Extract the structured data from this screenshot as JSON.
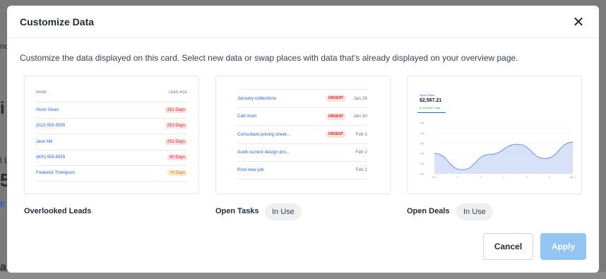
{
  "background": {
    "fragments": [
      "nd",
      "i",
      "l L",
      "5",
      "E",
      "al"
    ]
  },
  "modal": {
    "title": "Customize Data",
    "description": "Customize the data displayed on this card. Select new data or swap places with data that’s already displayed on your overview page.",
    "cancel_label": "Cancel",
    "apply_label": "Apply"
  },
  "cards": {
    "leads": {
      "label": "Overlooked Leads",
      "col_name": "NAME",
      "col_age": "LEAD AGE",
      "rows": [
        {
          "name": "Victor Swan",
          "age": "251 Days",
          "status": "red"
        },
        {
          "name": "(512) 555-5555",
          "age": "251 Days",
          "status": "red"
        },
        {
          "name": "Jane Hill",
          "age": "251 Days",
          "status": "red"
        },
        {
          "name": "(800) 555-5555",
          "age": "90 Days",
          "status": "red"
        },
        {
          "name": "Frederick Thompson",
          "age": "76 Days",
          "status": "orange"
        }
      ]
    },
    "tasks": {
      "label": "Open Tasks",
      "badge": "In Use",
      "rows": [
        {
          "name": "January collections",
          "urgent": "URGENT",
          "date": "Jan 28"
        },
        {
          "name": "Call mom",
          "urgent": "URGENT",
          "date": "Jan 30"
        },
        {
          "name": "Consultant pricing sheet...",
          "urgent": "URGENT",
          "date": "Feb 1"
        },
        {
          "name": "Audit current design pro...",
          "urgent": "",
          "date": "Feb 2"
        },
        {
          "name": "Post new job",
          "urgent": "",
          "date": "Feb 2"
        }
      ]
    },
    "deals": {
      "label": "Open Deals",
      "badge": "In Use",
      "box_label": "Open Deals",
      "box_value": "$2,587.21",
      "box_delta": "▲ 40% last 7 days",
      "y_ticks": [
        "$5k",
        "$4k",
        "$3k",
        "$2k",
        "$1k",
        "$0k"
      ],
      "x_ticks": [
        "Jan 1",
        "2",
        "3",
        "4",
        "5",
        "6",
        "Jan 7"
      ],
      "curve_values": [
        2.0,
        0.4,
        1.9,
        2.9,
        1.5,
        3.1
      ],
      "fill_color": "#c9d8f7",
      "line_color": "#6b8fe6"
    }
  },
  "colors": {
    "link_blue": "#2563eb",
    "apply_disabled": "#93c5f4"
  }
}
